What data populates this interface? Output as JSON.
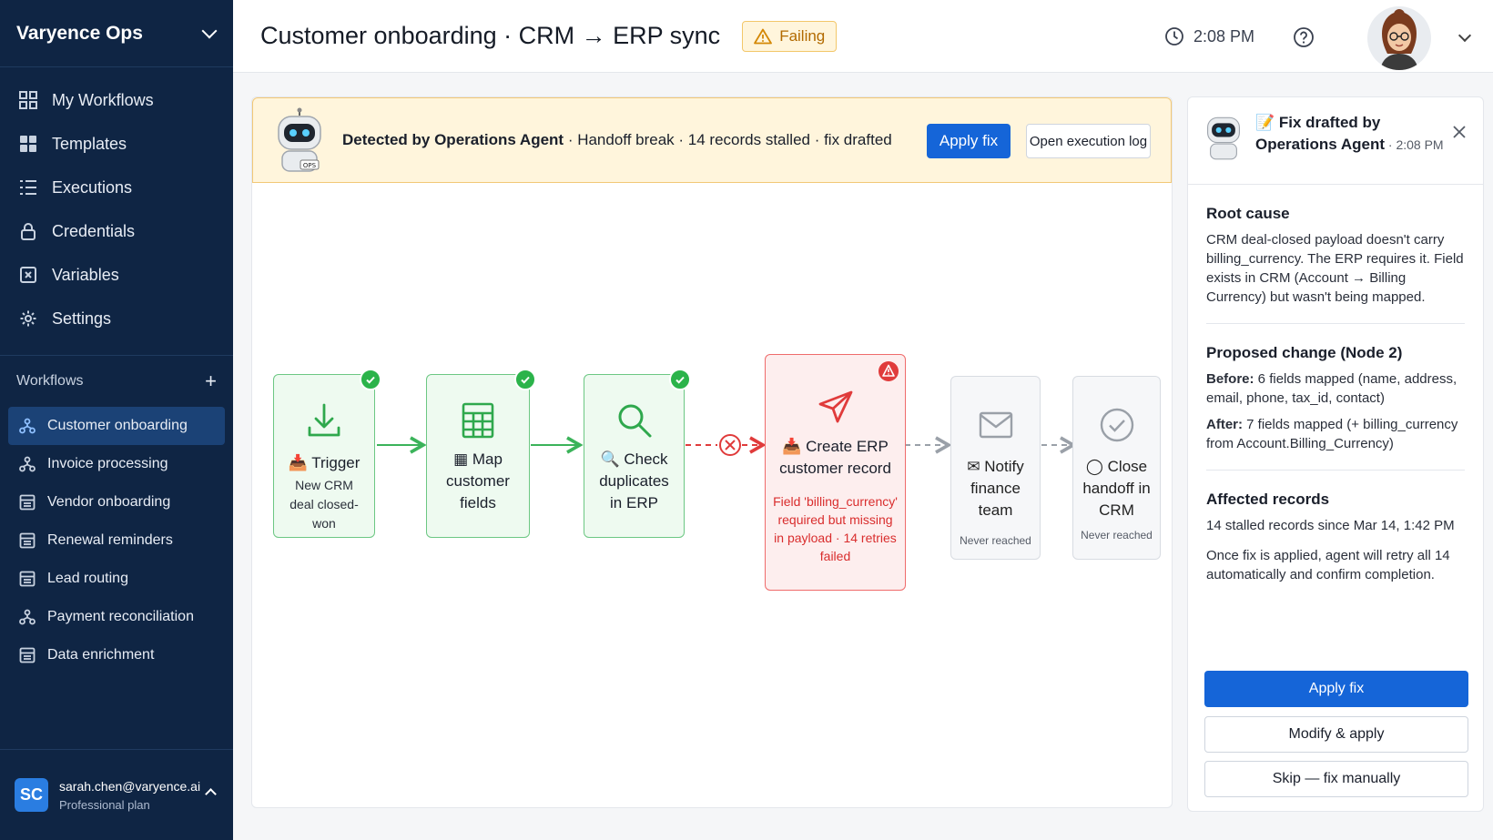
{
  "sidebar": {
    "brand": "Varyence Ops",
    "nav": [
      {
        "label": "My Workflows",
        "icon": "grid-icon"
      },
      {
        "label": "Templates",
        "icon": "templates-icon"
      },
      {
        "label": "Executions",
        "icon": "list-icon"
      },
      {
        "label": "Credentials",
        "icon": "lock-icon"
      },
      {
        "label": "Variables",
        "icon": "variable-icon"
      },
      {
        "label": "Settings",
        "icon": "gear-icon"
      }
    ],
    "workflows_heading": "Workflows",
    "workflows": [
      {
        "label": "Customer onboarding",
        "active": true
      },
      {
        "label": "Invoice processing"
      },
      {
        "label": "Vendor onboarding"
      },
      {
        "label": "Renewal reminders"
      },
      {
        "label": "Lead routing"
      },
      {
        "label": "Payment reconciliation"
      },
      {
        "label": "Data enrichment"
      }
    ],
    "user": {
      "initials": "SC",
      "email": "sarah.chen@varyence.ai",
      "plan": "Professional plan"
    }
  },
  "header": {
    "title": "Customer onboarding · CRM → ERP sync",
    "status": "Failing",
    "time": "2:08 PM"
  },
  "alert": {
    "agent": "Detected by Operations Agent",
    "detail": " · Handoff break · 14 records stalled · fix drafted",
    "apply_label": "Apply fix",
    "log_label": "Open execution log",
    "robot_tag": "OPS"
  },
  "nodes": [
    {
      "label": "Trigger",
      "sub": "New CRM deal closed-won",
      "status": "ok"
    },
    {
      "label": "Map customer fields",
      "status": "ok"
    },
    {
      "label": "Check duplicates in ERP",
      "status": "ok"
    },
    {
      "label": "Create ERP customer record",
      "status": "error",
      "error": "Field 'billing_currency' required but missing in payload · 14 retries failed"
    },
    {
      "label": "Notify finance team",
      "status": "never",
      "note": "Never reached"
    },
    {
      "label": "Close handoff in CRM",
      "status": "never",
      "note": "Never reached"
    }
  ],
  "panel": {
    "title_prefix": "Fix drafted by",
    "agent": "Operations Agent",
    "time": " · 2:08 PM",
    "root_cause_heading": "Root cause",
    "root_cause": "CRM deal-closed payload doesn't carry billing_currency. The ERP requires it. Field exists in CRM (Account → Billing Currency) but wasn't being mapped.",
    "change_heading": "Proposed change (Node 2)",
    "before_label": "Before:",
    "before_text": " 6 fields mapped (name, address, email, phone, tax_id, contact)",
    "after_label": "After:",
    "after_text": " 7 fields mapped (+ billing_currency from Account.Billing_Currency)",
    "affected_heading": "Affected records",
    "affected_text": "14 stalled records since Mar 14, 1:42 PM",
    "retry_text": "Once fix is applied, agent will retry all 14 automatically and confirm completion.",
    "apply_label": "Apply fix",
    "modify_label": "Modify & apply",
    "skip_label": "Skip — fix manually"
  },
  "colors": {
    "sidebar": "#0f2544",
    "primary": "#1565d8",
    "success": "#2bb34a",
    "error": "#d92d2d",
    "warning": "#f3c76a"
  }
}
